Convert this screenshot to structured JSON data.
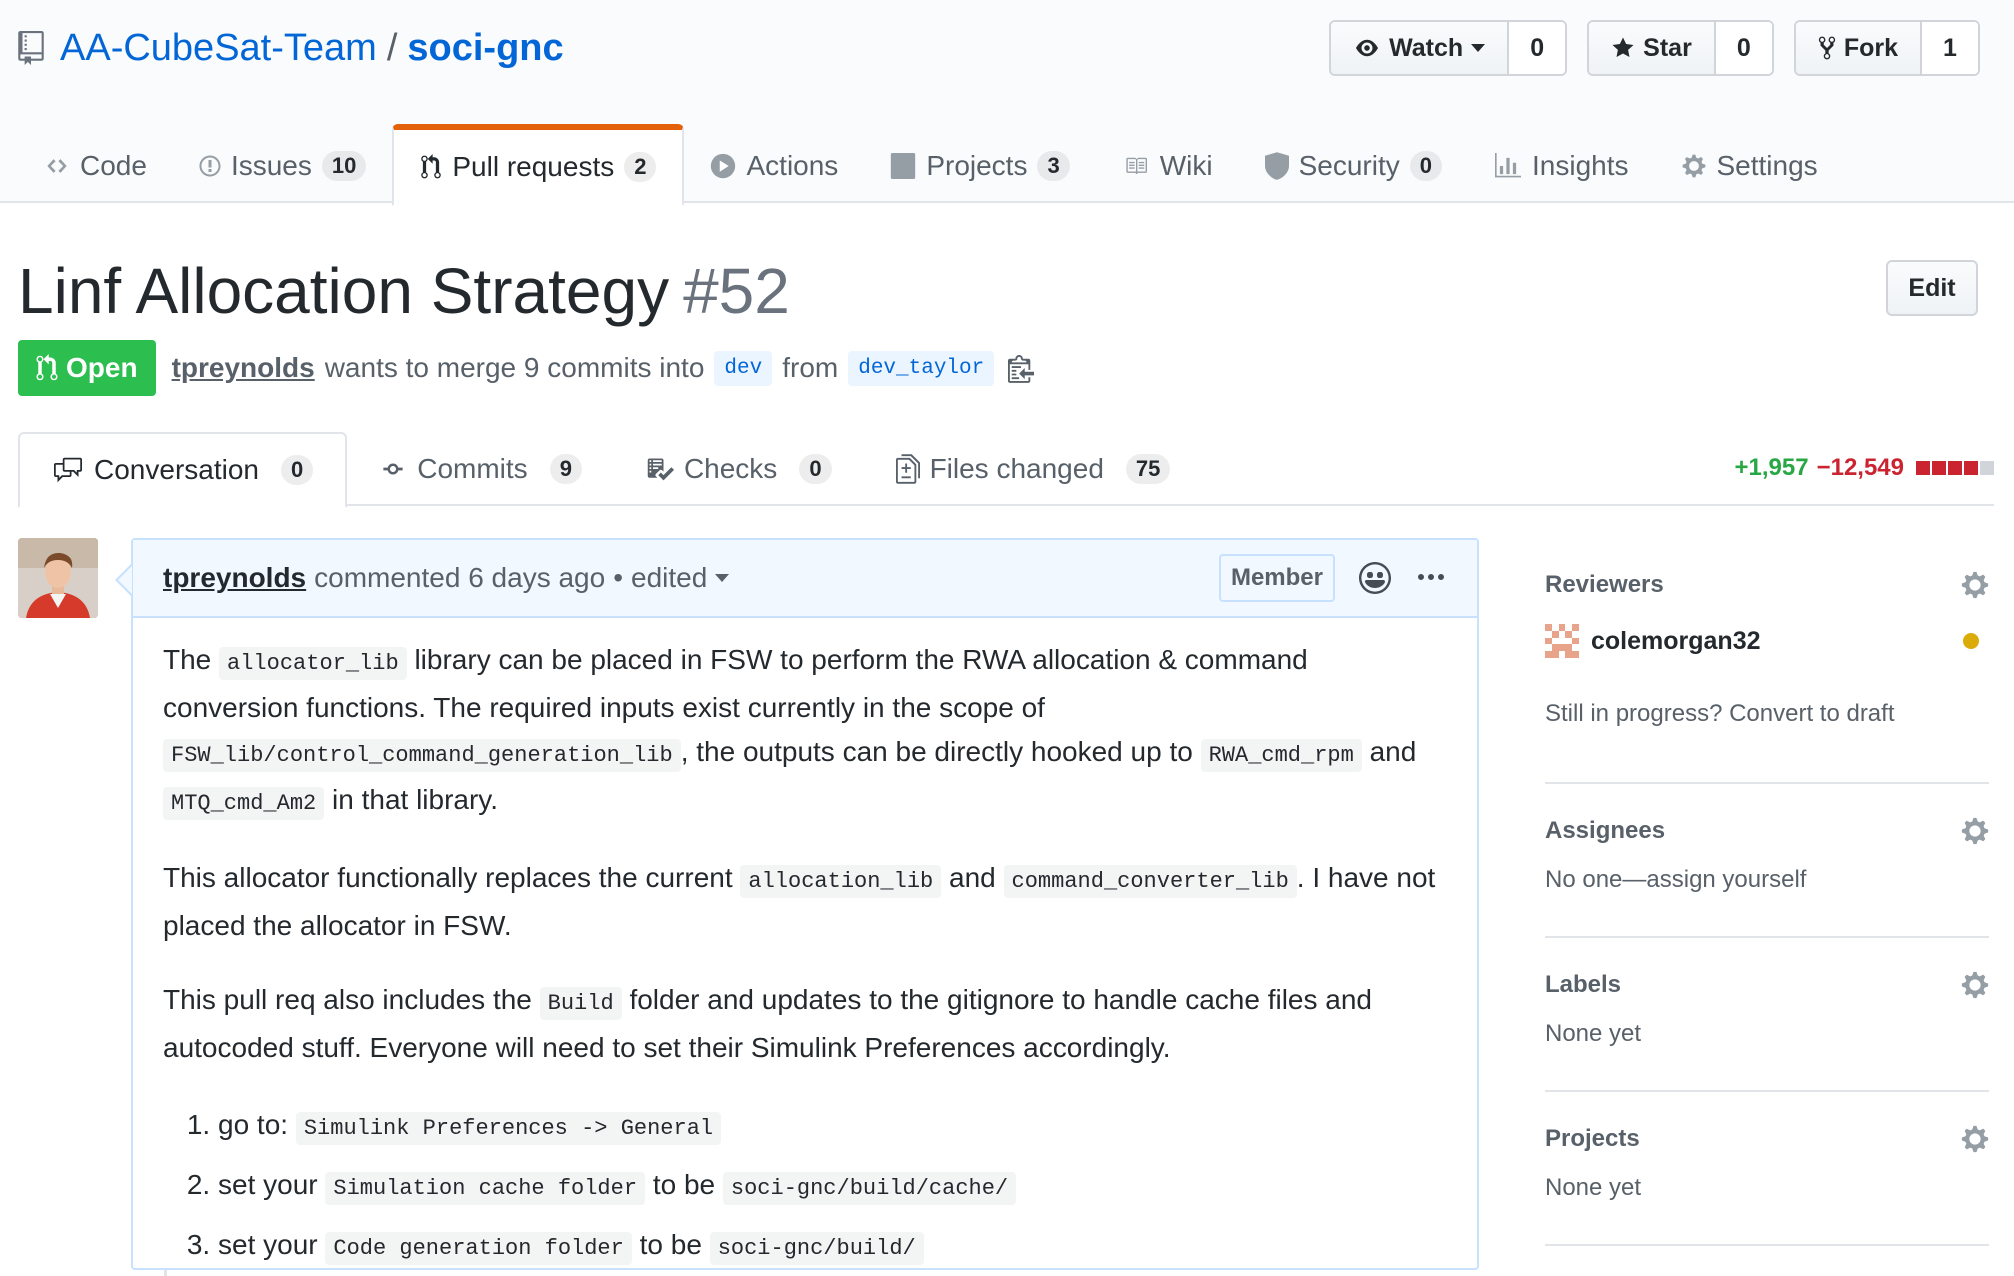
{
  "repo": {
    "owner": "AA-CubeSat-Team",
    "separator": "/",
    "name": "soci-gnc",
    "actions": {
      "watch_label": "Watch",
      "watch_count": "0",
      "star_label": "Star",
      "star_count": "0",
      "fork_label": "Fork",
      "fork_count": "1"
    }
  },
  "nav": {
    "items": [
      {
        "label": "Code",
        "count": null
      },
      {
        "label": "Issues",
        "count": "10"
      },
      {
        "label": "Pull requests",
        "count": "2"
      },
      {
        "label": "Actions",
        "count": null
      },
      {
        "label": "Projects",
        "count": "3"
      },
      {
        "label": "Wiki",
        "count": null
      },
      {
        "label": "Security",
        "count": "0"
      },
      {
        "label": "Insights",
        "count": null
      },
      {
        "label": "Settings",
        "count": null
      }
    ],
    "selected": "Pull requests"
  },
  "pr": {
    "title": "Linf Allocation Strategy",
    "number": "#52",
    "edit_label": "Edit",
    "state": "Open",
    "author": "tpreynolds",
    "meta_text": "wants to merge 9 commits into",
    "base_branch": "dev",
    "from_text": "from",
    "head_branch": "dev_taylor"
  },
  "tabs": [
    {
      "label": "Conversation",
      "count": "0"
    },
    {
      "label": "Commits",
      "count": "9"
    },
    {
      "label": "Checks",
      "count": "0"
    },
    {
      "label": "Files changed",
      "count": "75"
    }
  ],
  "diffstat": {
    "additions": "+1,957",
    "deletions": "−12,549",
    "colors": {
      "add": "#28a745",
      "del": "#cb2431",
      "neutral": "#d1d5da"
    }
  },
  "comment": {
    "author": "tpreynolds",
    "action": "commented 6 days ago",
    "dot": "•",
    "edited": "edited",
    "role_label": "Member",
    "body": {
      "p1": {
        "t1": "The",
        "c1": "allocator_lib",
        "t2": "library can be placed in FSW to perform the RWA allocation & command conversion functions. The required inputs exist currently in the scope of",
        "c2": "FSW_lib/control_command_generation_lib",
        "t3": ", the outputs can be directly hooked up to",
        "c3": "RWA_cmd_rpm",
        "t4": "and",
        "c4": "MTQ_cmd_Am2",
        "t5": "in that library."
      },
      "p2": {
        "t1": "This allocator functionally replaces the current",
        "c1": "allocation_lib",
        "t2": "and",
        "c2": "command_converter_lib",
        "t3": ". I have not placed the allocator in FSW."
      },
      "p3": {
        "t1": "This pull req also includes the",
        "c1": "Build",
        "t2": "folder and updates to the gitignore to handle cache files and autocoded stuff. Everyone will need to set their Simulink Preferences accordingly."
      },
      "steps": [
        {
          "t1": "go to:",
          "c1": "Simulink Preferences -> General"
        },
        {
          "t1": "set your",
          "c1": "Simulation cache folder",
          "t2": "to be",
          "c2": "soci-gnc/build/cache/"
        },
        {
          "t1": "set your",
          "c1": "Code generation folder",
          "t2": "to be",
          "c2": "soci-gnc/build/"
        }
      ]
    }
  },
  "sidebar": {
    "reviewers": {
      "heading": "Reviewers",
      "name": "colemorgan32",
      "status_color": "#dbab09",
      "draft_text": "Still in progress? Convert to draft"
    },
    "assignees": {
      "heading": "Assignees",
      "value": "No one—assign yourself"
    },
    "labels": {
      "heading": "Labels",
      "value": "None yet"
    },
    "projects": {
      "heading": "Projects",
      "value": "None yet"
    }
  }
}
